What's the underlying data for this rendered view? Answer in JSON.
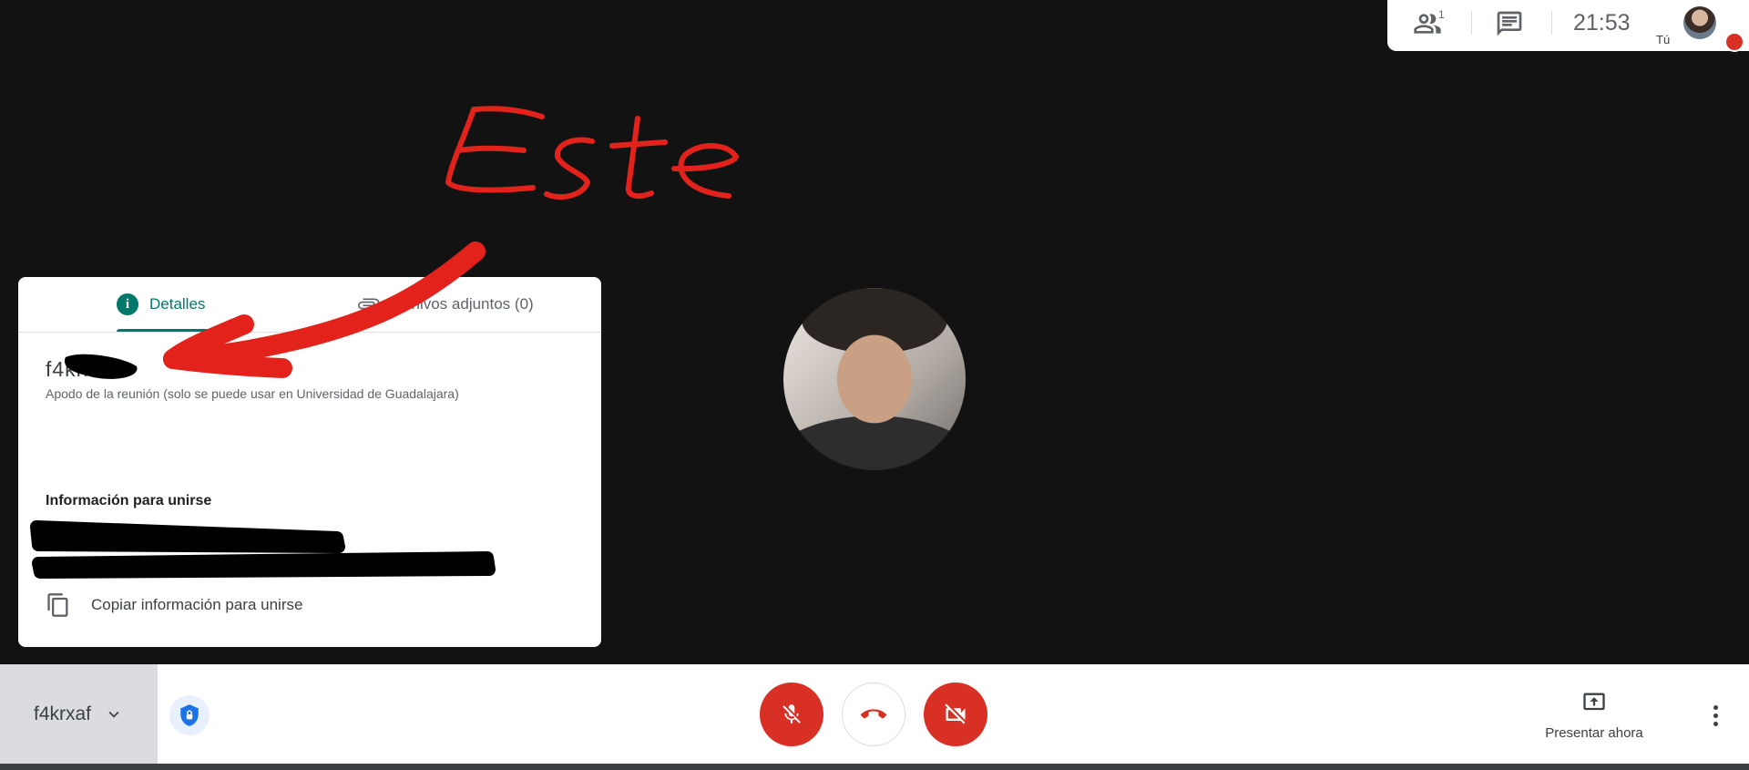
{
  "topbar": {
    "people_icon": "people-icon",
    "people_count": "1",
    "chat_icon": "chat-icon",
    "clock": "21:53",
    "self_label": "Tú"
  },
  "panel": {
    "tabs": [
      {
        "label": "Detalles",
        "icon": "info-icon",
        "active": true
      },
      {
        "label": "Archivos adjuntos (0)",
        "icon": "paperclip-icon",
        "active": false
      }
    ],
    "meeting_code": "f4krxaf",
    "nickname_hint": "Apodo de la reunión (solo se puede usar en Universidad de Guadalajara)",
    "join_heading": "Información para unirse",
    "join_line_1": "",
    "join_line_2": "",
    "copy_label": "Copiar información para unirse"
  },
  "bottombar": {
    "meeting_code": "f4krxaf",
    "present_label": "Presentar ahora"
  },
  "annotation": {
    "text": "Este",
    "color": "#e3221c"
  },
  "colors": {
    "accent": "#00796b",
    "danger": "#d93025",
    "background": "#121212"
  }
}
